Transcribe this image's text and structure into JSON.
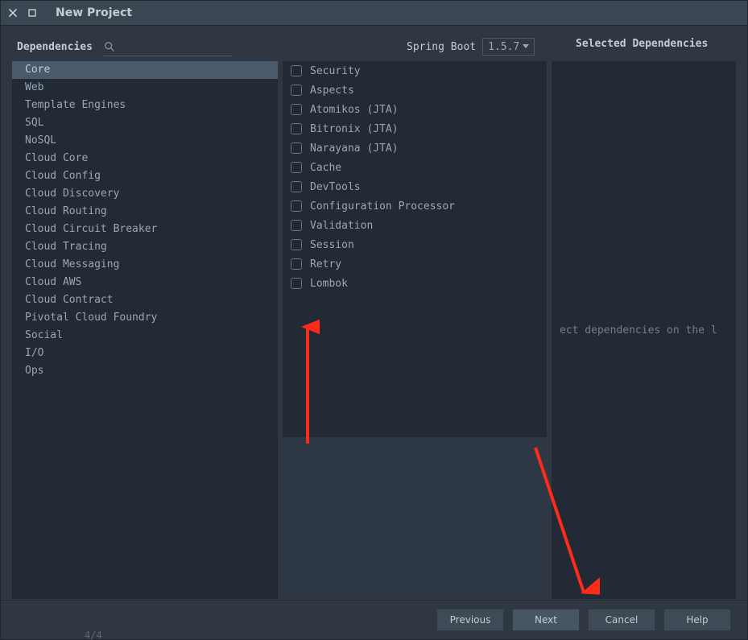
{
  "window": {
    "title": "New Project"
  },
  "header": {
    "dependencies_label": "Dependencies",
    "spring_boot_label": "Spring Boot",
    "spring_boot_version": "1.5.7",
    "selected_label": "Selected Dependencies",
    "search_placeholder": ""
  },
  "categories": [
    "Core",
    "Web",
    "Template Engines",
    "SQL",
    "NoSQL",
    "Cloud Core",
    "Cloud Config",
    "Cloud Discovery",
    "Cloud Routing",
    "Cloud Circuit Breaker",
    "Cloud Tracing",
    "Cloud Messaging",
    "Cloud AWS",
    "Cloud Contract",
    "Pivotal Cloud Foundry",
    "Social",
    "I/O",
    "Ops"
  ],
  "selected_category_index": 0,
  "dependencies": [
    "Security",
    "Aspects",
    "Atomikos (JTA)",
    "Bitronix (JTA)",
    "Narayana (JTA)",
    "Cache",
    "DevTools",
    "Configuration Processor",
    "Validation",
    "Session",
    "Retry",
    "Lombok"
  ],
  "selected_hint": "ect dependencies on the l",
  "buttons": {
    "previous": "Previous",
    "next": "Next",
    "cancel": "Cancel",
    "help": "Help"
  },
  "footer_counter": "4/4"
}
